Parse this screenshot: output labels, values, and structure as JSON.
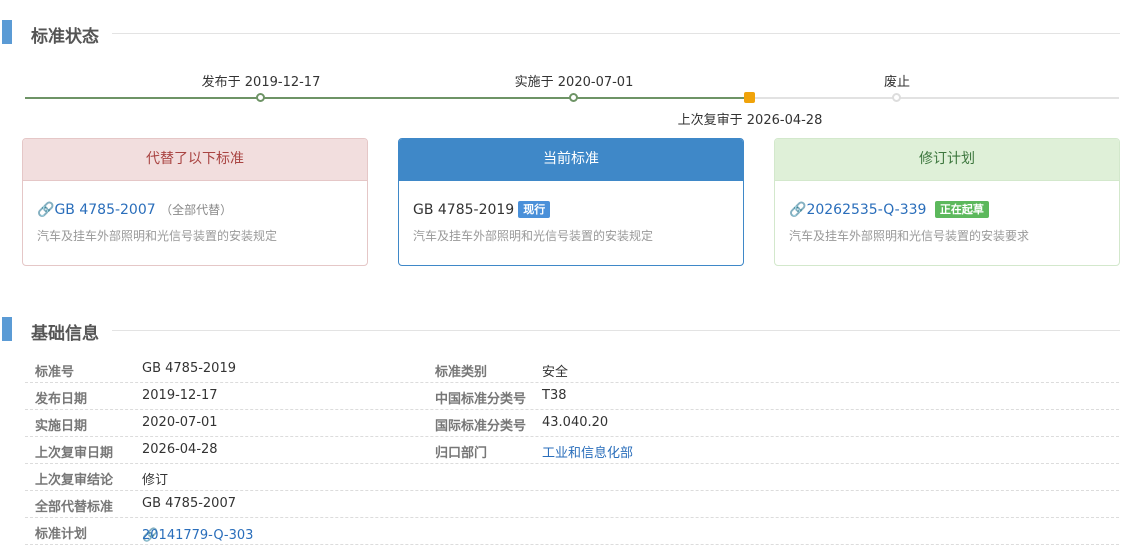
{
  "status_section": {
    "title": "标准状态"
  },
  "timeline": {
    "published": "发布于 2019-12-17",
    "implemented": "实施于 2020-07-01",
    "last_review": "上次复审于 2026-04-28",
    "abolished": "废止"
  },
  "colors": {
    "accent": "#5b9bd5",
    "timeline_done": "#6e9466",
    "review_node": "#f0a30a",
    "pending": "#dddddd"
  },
  "cards": {
    "replaced": {
      "header": "代替了以下标准",
      "code": "GB 4785-2007",
      "note": "（全部代替）",
      "desc": "汽车及挂车外部照明和光信号装置的安装规定"
    },
    "current": {
      "header": "当前标准",
      "code": "GB 4785-2019",
      "badge": "现行",
      "desc": "汽车及挂车外部照明和光信号装置的安装规定"
    },
    "plan": {
      "header": "修订计划",
      "code": "20262535-Q-339",
      "badge": "正在起草",
      "desc": "汽车及挂车外部照明和光信号装置的安装要求"
    }
  },
  "basic_section": {
    "title": "基础信息"
  },
  "basic_info": {
    "rows": [
      {
        "label": "标准号",
        "value": "GB 4785-2019",
        "label2": "标准类别",
        "value2": "安全"
      },
      {
        "label": "发布日期",
        "value": "2019-12-17",
        "label2": "中国标准分类号",
        "value2": "T38"
      },
      {
        "label": "实施日期",
        "value": "2020-07-01",
        "label2": "国际标准分类号",
        "value2": "43.040.20"
      },
      {
        "label": "上次复审日期",
        "value": "2026-04-28",
        "label2": "归口部门",
        "value2": "工业和信息化部"
      },
      {
        "label": "上次复审结论",
        "value": "修订"
      },
      {
        "label": "全部代替标准",
        "value": "GB 4785-2007"
      },
      {
        "label": "标准计划",
        "value": "20141779-Q-303"
      }
    ]
  }
}
